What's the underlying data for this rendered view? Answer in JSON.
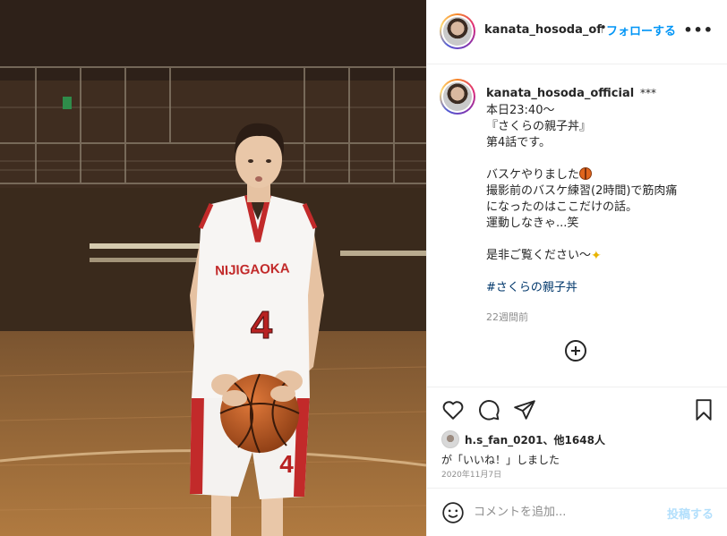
{
  "header": {
    "username": "kanata_hosoda_offi",
    "separator": "•",
    "follow_label": "フォローする",
    "more_label": "•••"
  },
  "photo": {
    "jersey_team": "NIJIGAOKA",
    "jersey_number": "4",
    "shorts_number": "4"
  },
  "caption": {
    "username": "kanata_hosoda_official",
    "verified_mark": "***",
    "lines": [
      "本日23:40〜",
      "『さくらの親子丼』",
      "第4話です。",
      "",
      "バスケやりました",
      "撮影前のバスケ練習(2時間)で筋肉痛",
      "になったのはここだけの話。",
      "運動しなきゃ...笑",
      "",
      "是非ご覧ください〜",
      "",
      "#さくらの親子丼"
    ],
    "time_ago": "22週間前"
  },
  "likes": {
    "user": "h.s_fan_0201",
    "others": "、他1648人",
    "line2": "が「いいね！」しました",
    "date": "2020年11月7日"
  },
  "comment": {
    "placeholder": "コメントを追加...",
    "post_label": "投稿する"
  },
  "colors": {
    "accent": "#0095f6",
    "hashtag": "#00376b",
    "muted": "#8e8e8e",
    "post_disabled": "#b2dffc"
  },
  "icons": [
    "heart-icon",
    "comment-icon",
    "share-icon",
    "bookmark-icon",
    "smile-icon",
    "add-circle-icon",
    "more-icon"
  ]
}
